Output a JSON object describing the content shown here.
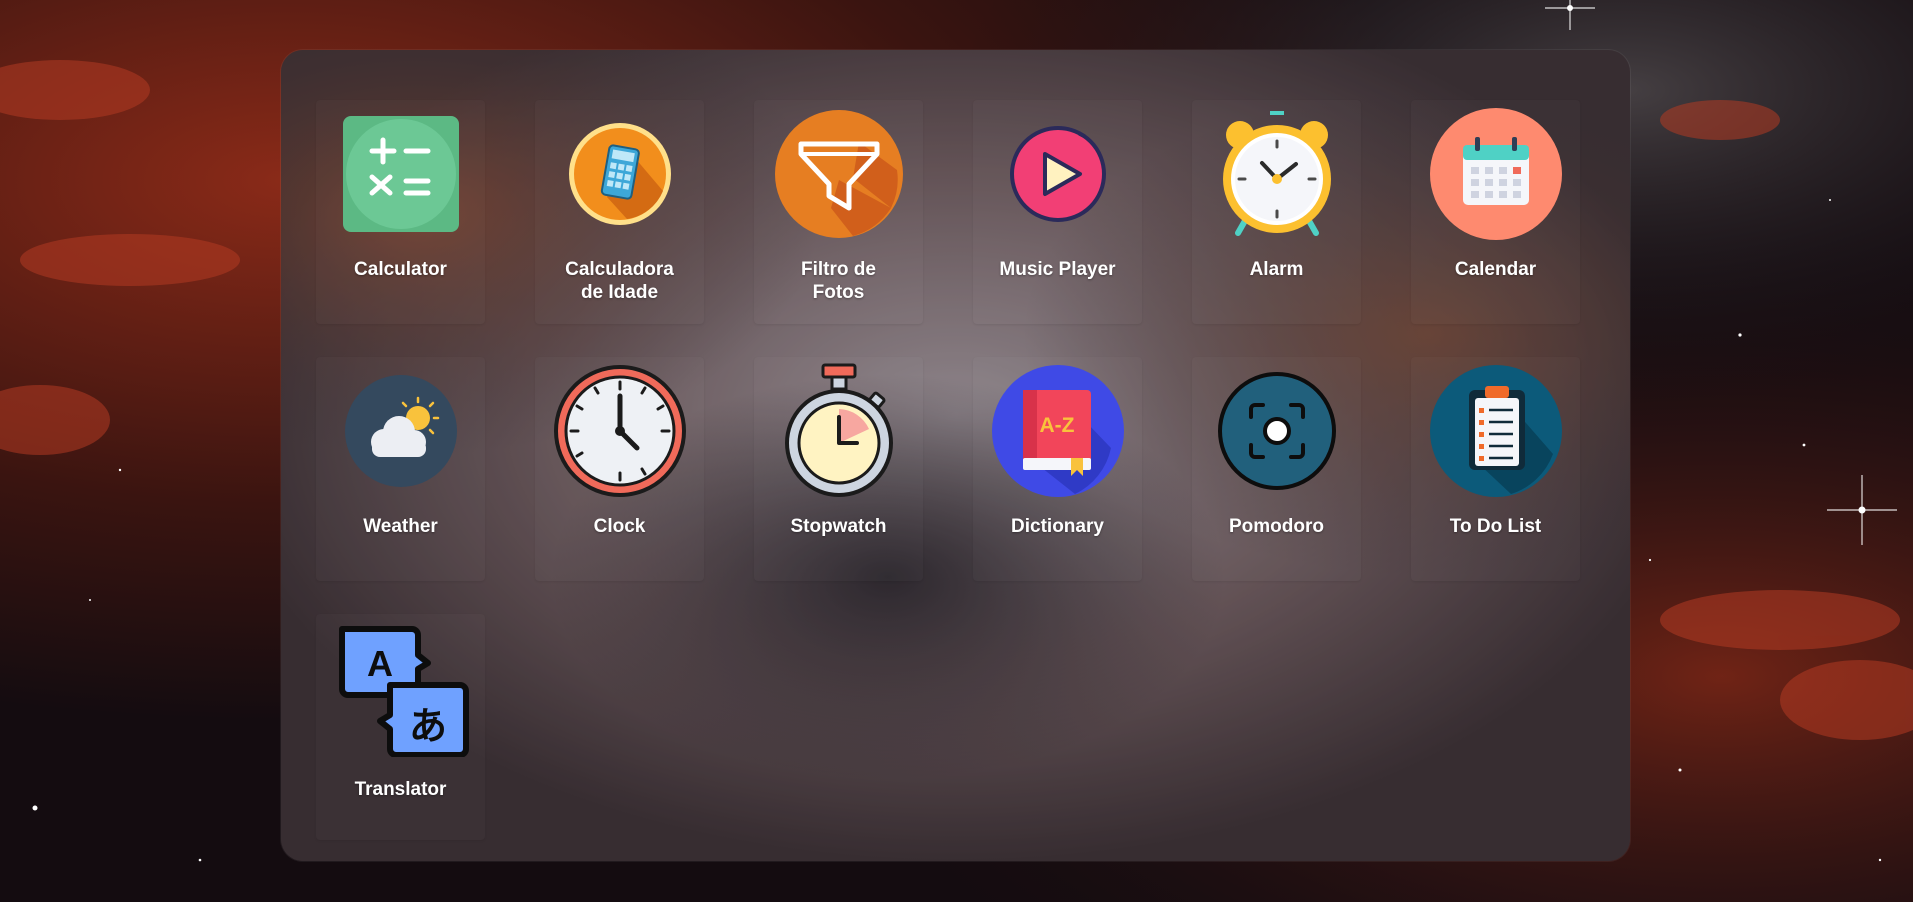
{
  "apps": [
    {
      "name": "Calculator",
      "lines": [
        "Calculator"
      ],
      "icon": "calculator-icon"
    },
    {
      "name": "Calculadora de Idade",
      "lines": [
        "Calculadora",
        "de Idade"
      ],
      "icon": "age-calculator-icon"
    },
    {
      "name": "Filtro de Fotos",
      "lines": [
        "Filtro de",
        "Fotos"
      ],
      "icon": "funnel-filter-icon"
    },
    {
      "name": "Music Player",
      "lines": [
        "Music Player"
      ],
      "icon": "play-button-icon"
    },
    {
      "name": "Alarm",
      "lines": [
        "Alarm"
      ],
      "icon": "alarm-clock-icon"
    },
    {
      "name": "Calendar",
      "lines": [
        "Calendar"
      ],
      "icon": "calendar-icon"
    },
    {
      "name": "Weather",
      "lines": [
        "Weather"
      ],
      "icon": "cloud-sun-icon"
    },
    {
      "name": "Clock",
      "lines": [
        "Clock"
      ],
      "icon": "wall-clock-icon"
    },
    {
      "name": "Stopwatch",
      "lines": [
        "Stopwatch"
      ],
      "icon": "stopwatch-icon"
    },
    {
      "name": "Dictionary",
      "lines": [
        "Dictionary"
      ],
      "icon": "dictionary-book-icon"
    },
    {
      "name": "Pomodoro",
      "lines": [
        "Pomodoro"
      ],
      "icon": "focus-target-icon"
    },
    {
      "name": "To Do List",
      "lines": [
        "To Do List"
      ],
      "icon": "clipboard-checklist-icon"
    },
    {
      "name": "Translator",
      "lines": [
        "Translator"
      ],
      "icon": "translate-bubbles-icon"
    }
  ],
  "icon_text": {
    "dictionary_mark": "A-Z",
    "translator_latin": "A",
    "translator_kana": "あ"
  },
  "colors": {
    "calculator_green": "#5cb984",
    "age_calc_orange": "#f28e1c",
    "filter_orange": "#e67e22",
    "music_pink": "#f23f75",
    "alarm_yellow": "#fcc02f",
    "calendar_salmon": "#fe8a6f",
    "weather_slate": "#34495e",
    "clock_red": "#f06a5a",
    "dictionary_blue": "#3f4ae6",
    "pomodoro_teal": "#21607c",
    "todo_teal": "#0c5a7a",
    "translator_blue": "#6fa1ff"
  }
}
